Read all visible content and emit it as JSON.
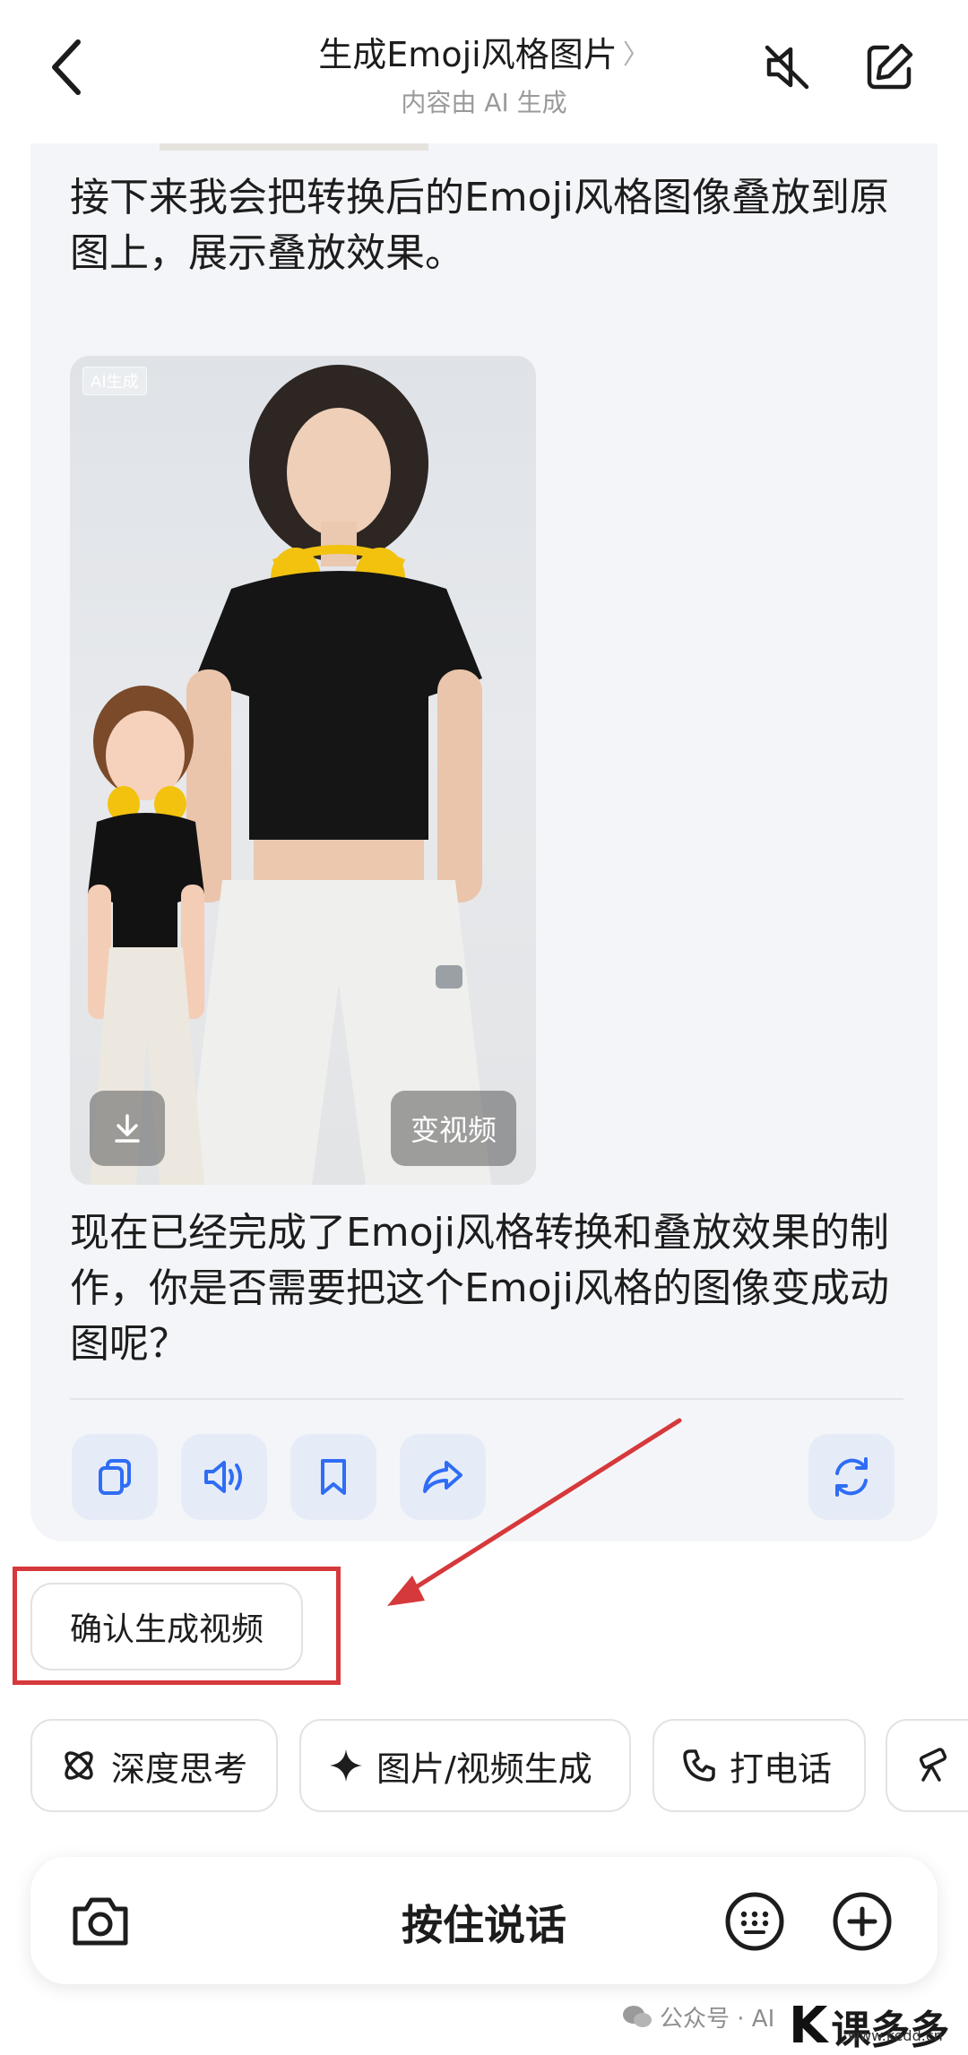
{
  "header": {
    "title": "生成Emoji风格图片",
    "title_chevron": "〉",
    "subtitle": "内容由 AI 生成"
  },
  "messages": {
    "m1": "接下来我会把转换后的Emoji风格图像叠放到原图上，展示叠放效果。",
    "m2": "现在已经完成了Emoji风格转换和叠放效果的制作，你是否需要把这个Emoji风格的图像变成动图呢？"
  },
  "image_card": {
    "ai_tag": "AI生成",
    "to_video_label": "变视频"
  },
  "actions": {
    "copy_icon": "copy-icon",
    "speaker_icon": "speaker-icon",
    "bookmark_icon": "bookmark-icon",
    "share_icon": "share-icon",
    "regenerate_icon": "refresh-icon"
  },
  "suggestion": {
    "confirm_label": "确认生成视频"
  },
  "quick_chips": {
    "deep_think": "深度思考",
    "image_video": "图片/视频生成",
    "call": "打电话"
  },
  "input_bar": {
    "hold_to_talk": "按住说话"
  },
  "watermark": {
    "left": "公众号 · AI",
    "brand": "课多多",
    "domain": "www.kedd.cn"
  },
  "colors": {
    "accent_blue": "#2f6df6",
    "action_bg": "#e6ecf7",
    "highlight_red": "#d6393b"
  }
}
